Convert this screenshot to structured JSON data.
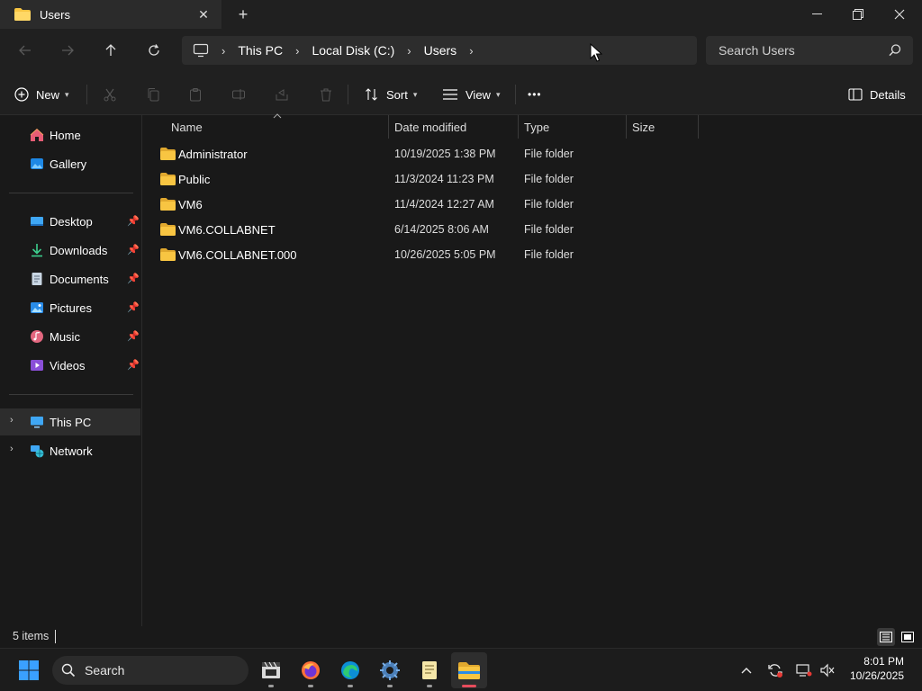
{
  "window": {
    "tab_title": "Users",
    "new_tab_symbol": "+",
    "tab_close_symbol": "✕",
    "minimize_symbol": "—",
    "maximize_symbol": "❐",
    "close_symbol": "✕"
  },
  "breadcrumb": {
    "items": [
      "This PC",
      "Local Disk (C:)",
      "Users"
    ]
  },
  "search": {
    "placeholder": "Search Users"
  },
  "toolbar": {
    "new_label": "New",
    "sort_label": "Sort",
    "view_label": "View",
    "more_label": "•••",
    "details_label": "Details"
  },
  "sidebar": {
    "items": [
      {
        "label": "Home",
        "icon": "home-icon",
        "pinned": false
      },
      {
        "label": "Gallery",
        "icon": "gallery-icon",
        "pinned": false
      },
      {
        "label": "Desktop",
        "icon": "desktop-icon",
        "pinned": true
      },
      {
        "label": "Downloads",
        "icon": "downloads-icon",
        "pinned": true
      },
      {
        "label": "Documents",
        "icon": "documents-icon",
        "pinned": true
      },
      {
        "label": "Pictures",
        "icon": "pictures-icon",
        "pinned": true
      },
      {
        "label": "Music",
        "icon": "music-icon",
        "pinned": true
      },
      {
        "label": "Videos",
        "icon": "videos-icon",
        "pinned": true
      },
      {
        "label": "This PC",
        "icon": "this-pc-icon",
        "selected": true
      },
      {
        "label": "Network",
        "icon": "network-icon"
      }
    ]
  },
  "filelist": {
    "columns": [
      "Name",
      "Date modified",
      "Type",
      "Size"
    ],
    "rows": [
      {
        "name": "Administrator",
        "date": "10/19/2025 1:38 PM",
        "type": "File folder",
        "size": ""
      },
      {
        "name": "Public",
        "date": "11/3/2024 11:23 PM",
        "type": "File folder",
        "size": ""
      },
      {
        "name": "VM6",
        "date": "11/4/2024 12:27 AM",
        "type": "File folder",
        "size": ""
      },
      {
        "name": "VM6.COLLABNET",
        "date": "6/14/2025 8:06 AM",
        "type": "File folder",
        "size": ""
      },
      {
        "name": "VM6.COLLABNET.000",
        "date": "10/26/2025 5:05 PM",
        "type": "File folder",
        "size": ""
      }
    ]
  },
  "status": {
    "item_count": "5 items"
  },
  "taskbar": {
    "search_label": "Search",
    "time": "8:01 PM",
    "date": "10/26/2025"
  },
  "colors": {
    "folder_yellow": "#f8c542",
    "accent_blue": "#4cc2ff",
    "active_indicator": "#e74c5c"
  }
}
